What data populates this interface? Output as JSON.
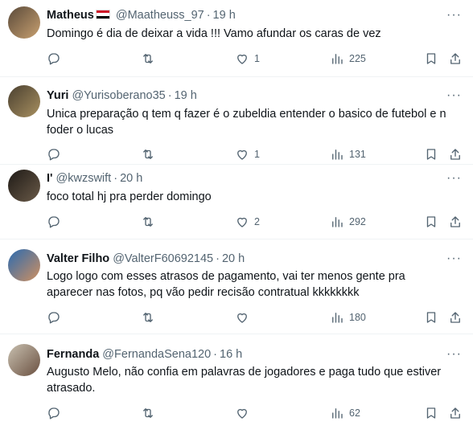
{
  "tweets": [
    {
      "name": "Matheus",
      "has_flag": true,
      "handle": "@Maatheuss_97",
      "time": "19 h",
      "lines": [
        "Domingo é dia de deixar a vida !!! Vamo afundar os caras de vez"
      ],
      "likes": "1",
      "views": "225",
      "avatar_colors": [
        "#5a4a3a",
        "#c8a070"
      ]
    },
    {
      "name": "Yuri",
      "has_flag": false,
      "handle": "@Yurisoberano35",
      "time": "19 h",
      "lines": [
        "Unica preparação q tem q fazer é o zubeldia entender o basico de futebol e n",
        "foder o lucas"
      ],
      "likes": "1",
      "views": "131",
      "avatar_colors": [
        "#4a4030",
        "#a89060"
      ]
    },
    {
      "name": "I'",
      "has_flag": false,
      "handle": "@kwzswift",
      "time": "20 h",
      "lines": [
        "foco total hj pra perder domingo"
      ],
      "likes": "2",
      "views": "292",
      "avatar_colors": [
        "#1e1a16",
        "#6a5a48"
      ]
    },
    {
      "name": "Valter Filho",
      "has_flag": false,
      "handle": "@ValterF60692145",
      "time": "20 h",
      "lines": [
        "Logo logo com esses atrasos de pagamento, vai ter menos gente pra",
        "aparecer nas fotos, pq vão pedir recisão contratual kkkkkkkk"
      ],
      "likes": "",
      "views": "180",
      "avatar_colors": [
        "#2a6ab0",
        "#d09060"
      ]
    },
    {
      "name": "Fernanda",
      "has_flag": false,
      "handle": "@FernandaSena120",
      "time": "16 h",
      "lines": [
        "Augusto Melo, não confia em palavras de jogadores e paga tudo que estiver",
        "atrasado."
      ],
      "likes": "",
      "views": "62",
      "avatar_colors": [
        "#c8c0b0",
        "#6a5040"
      ]
    }
  ],
  "icons": {
    "reply": "reply-icon",
    "retweet": "retweet-icon",
    "like": "heart-icon",
    "views": "views-icon",
    "bookmark": "bookmark-icon",
    "share": "share-icon",
    "more": "more-icon"
  },
  "colors": {
    "text": "#0f1419",
    "muted": "#536471",
    "divider": "#eff3f4"
  }
}
